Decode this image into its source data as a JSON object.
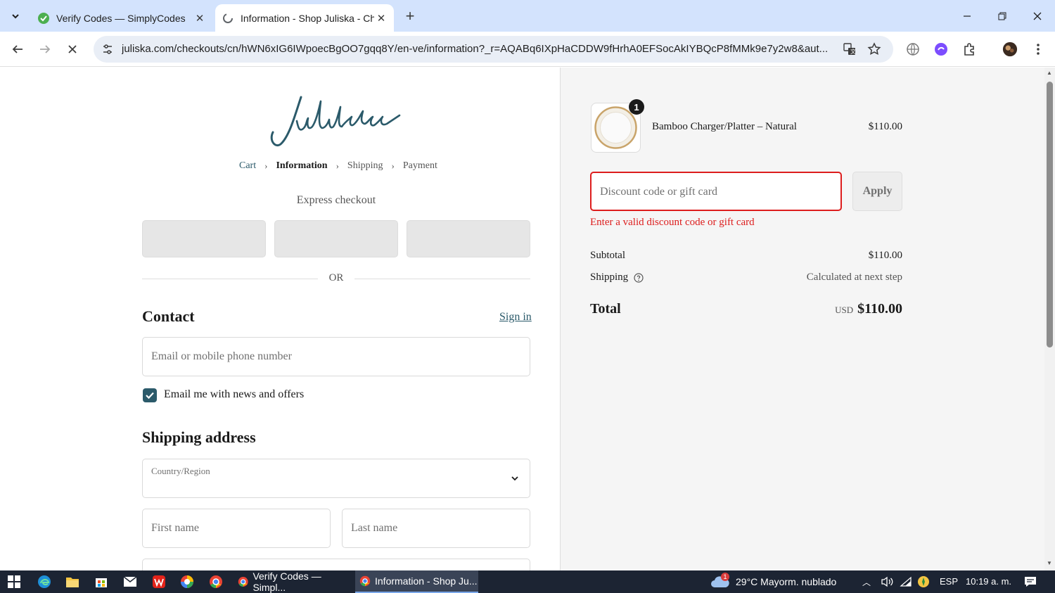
{
  "browser": {
    "tabs": [
      {
        "title": "Verify Codes — SimplyCodes",
        "active": false
      },
      {
        "title": "Information - Shop Juliska - Che",
        "active": true
      }
    ],
    "url": "juliska.com/checkouts/cn/hWN6xIG6IWpoecBgOO7gqq8Y/en-ve/information?_r=AQABq6IXpHaCDDW9fHrhA0EFSocAkIYBQcP8fMMk9e7y2w8&aut..."
  },
  "checkout": {
    "logo": "Juliska",
    "breadcrumbs": [
      "Cart",
      "Information",
      "Shipping",
      "Payment"
    ],
    "express_title": "Express checkout",
    "or_label": "OR",
    "contact_heading": "Contact",
    "sign_in": "Sign in",
    "email_placeholder": "Email or mobile phone number",
    "newsletter_label": "Email me with news and offers",
    "newsletter_checked": true,
    "shipping_heading": "Shipping address",
    "country_label": "Country/Region",
    "first_name_placeholder": "First name",
    "last_name_placeholder": "Last name"
  },
  "summary": {
    "item": {
      "name": "Bamboo Charger/Platter – Natural",
      "price": "$110.00",
      "quantity": "1"
    },
    "discount_placeholder": "Discount code or gift card",
    "apply_label": "Apply",
    "error": "Enter a valid discount code or gift card",
    "subtotal_label": "Subtotal",
    "subtotal_value": "$110.00",
    "shipping_label": "Shipping",
    "shipping_value": "Calculated at next step",
    "total_label": "Total",
    "currency": "USD",
    "total_value": "$110.00"
  },
  "taskbar": {
    "apps": [
      {
        "title": "Verify Codes — Simpl...",
        "active": false
      },
      {
        "title": "Information - Shop Ju...",
        "active": true
      }
    ],
    "weather_badge": "1",
    "weather": "29°C  Mayorm. nublado",
    "lang": "ESP",
    "time": "10:19 a. m."
  },
  "colors": {
    "accent": "#2b5a6a",
    "error": "#dd1d1d",
    "tabbar": "#d3e3fd",
    "summary_bg": "#f5f5f5"
  }
}
